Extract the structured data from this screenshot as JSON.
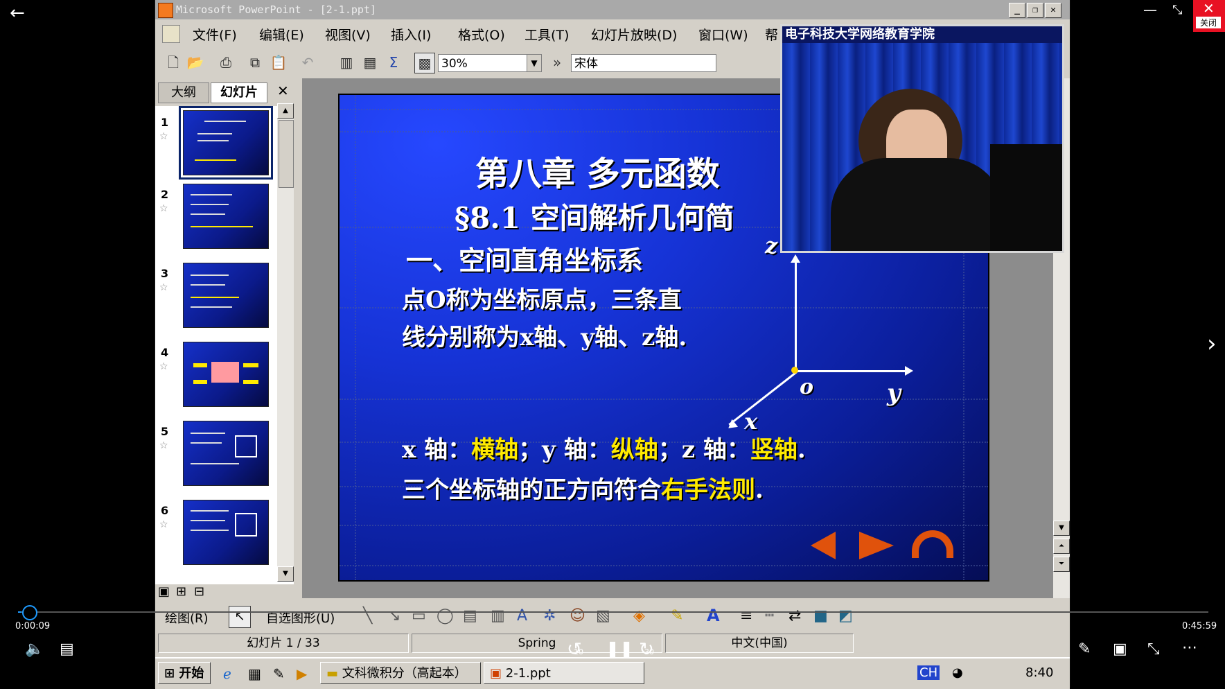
{
  "ppt": {
    "title": "Microsoft PowerPoint - [2-1.ppt]",
    "menu": [
      "文件(F)",
      "编辑(E)",
      "视图(V)",
      "插入(I)",
      "格式(O)",
      "工具(T)",
      "幻灯片放映(D)",
      "窗口(W)",
      "帮"
    ],
    "zoom": "30%",
    "font": "宋体",
    "tabs": {
      "outline": "大纲",
      "slides": "幻灯片"
    },
    "thumbnails": [
      "1",
      "2",
      "3",
      "4",
      "5",
      "6"
    ],
    "selected_thumbnail": 1
  },
  "slide": {
    "chapter": "第八章   多元函数",
    "section": "§8.1   空间解析几何简",
    "heading": "一、空间直角坐标系",
    "line1": "点O称为坐标原点，三条直",
    "line2": "线分别称为x轴、y轴、z轴.",
    "axis_x_label": "x",
    "axis_y_label": "y",
    "axis_z_label": "z",
    "origin_label": "o",
    "names": {
      "x_prefix": "x 轴：",
      "x_name": "横轴",
      "y_prefix": "；y 轴：",
      "y_name": "纵轴",
      "z_prefix": "；z 轴：",
      "z_name": "竖轴",
      "end": "."
    },
    "rule": {
      "prefix": "三个坐标轴的正方向符合",
      "highlight": "右手法则",
      "end": "."
    }
  },
  "drawbar": {
    "draw": "绘图(R)",
    "autoshape": "自选图形(U)"
  },
  "status": {
    "slide_count": "幻灯片 1 / 33",
    "design": "Spring",
    "language": "中文(中国)"
  },
  "taskbar": {
    "start": "开始",
    "folder": "文科微积分（高起本）",
    "file": "2-1.ppt",
    "time": "8:40",
    "ime": "CH"
  },
  "camera": {
    "caption": "电子科技大学网络教育学院"
  },
  "player": {
    "elapsed": "0:00:09",
    "duration": "0:45:59",
    "progress": 0.003,
    "close_label": "关闭",
    "rewind_seconds": "10",
    "forward_seconds": "30"
  }
}
